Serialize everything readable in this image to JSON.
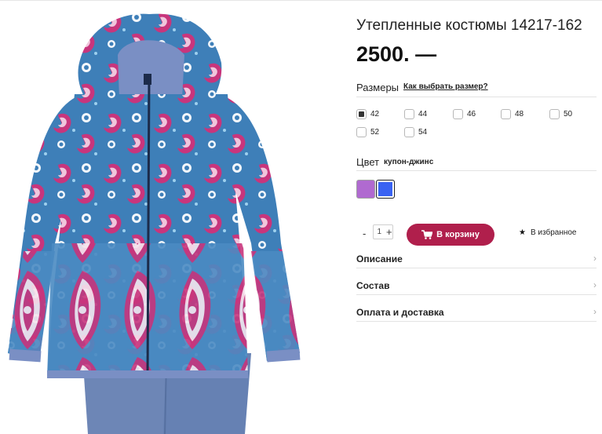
{
  "product": {
    "title": "Утепленные костюмы 14217-162",
    "price": "2500. —",
    "image_alt": "paisley-pattern-winter-jacket"
  },
  "sizes": {
    "label": "Размеры",
    "guide_link": "Как выбрать размер?",
    "options": [
      {
        "label": "42",
        "selected": true
      },
      {
        "label": "44",
        "selected": false
      },
      {
        "label": "46",
        "selected": false
      },
      {
        "label": "48",
        "selected": false
      },
      {
        "label": "50",
        "selected": false
      },
      {
        "label": "52",
        "selected": false
      },
      {
        "label": "54",
        "selected": false
      }
    ]
  },
  "color": {
    "label": "Цвет",
    "value": "купон-джинс",
    "swatches": [
      {
        "hex": "#b06ad0",
        "selected": false
      },
      {
        "hex": "#3a63f2",
        "selected": true
      }
    ]
  },
  "quantity": {
    "minus": "-",
    "value": "1",
    "plus": "+"
  },
  "cart_button": {
    "label": "В корзину",
    "color": "#b01f4c"
  },
  "favorite": {
    "star": "★",
    "label": "В избранное"
  },
  "accordion": [
    {
      "label": "Описание"
    },
    {
      "label": "Состав"
    },
    {
      "label": "Оплата и доставка"
    }
  ],
  "chevron": "›"
}
